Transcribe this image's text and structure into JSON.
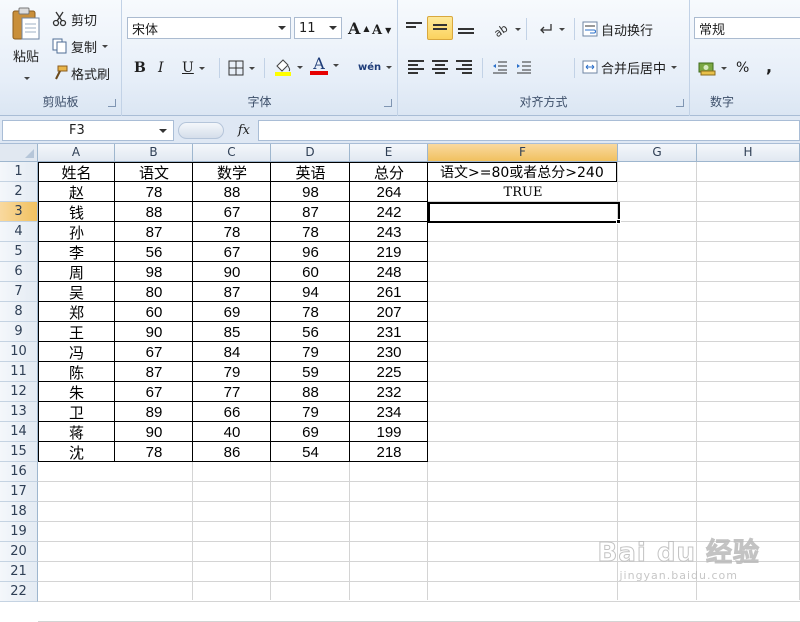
{
  "ribbon": {
    "clipboard": {
      "label": "剪贴板",
      "paste": "粘贴",
      "cut": "剪切",
      "copy": "复制",
      "format_painter": "格式刷"
    },
    "font": {
      "label": "字体",
      "font_name": "宋体",
      "font_size": "11",
      "bold": "B",
      "italic": "I",
      "underline": "U",
      "font_color_letter": "A",
      "phonetic": "wén",
      "grow": "A",
      "shrink": "A"
    },
    "alignment": {
      "label": "对齐方式",
      "wrap_text": "自动换行",
      "merge_center": "合并后居中"
    },
    "number": {
      "label": "数字",
      "format": "常规",
      "percent": "%",
      "comma": ","
    }
  },
  "formula_bar": {
    "name_box": "F3",
    "fx": "fx",
    "formula": ""
  },
  "sheet": {
    "active_cell": "F3",
    "columns": [
      "A",
      "B",
      "C",
      "D",
      "E",
      "F",
      "G",
      "H"
    ],
    "rows": [
      "1",
      "2",
      "3",
      "4",
      "5",
      "6",
      "7",
      "8",
      "9",
      "10",
      "11",
      "12",
      "13",
      "14",
      "15",
      "16",
      "17",
      "18",
      "19",
      "20",
      "21",
      "22"
    ],
    "headers": [
      "姓名",
      "语文",
      "数学",
      "英语",
      "总分"
    ],
    "records": [
      [
        "赵",
        "78",
        "88",
        "98",
        "264"
      ],
      [
        "钱",
        "88",
        "67",
        "87",
        "242"
      ],
      [
        "孙",
        "87",
        "78",
        "78",
        "243"
      ],
      [
        "李",
        "56",
        "67",
        "96",
        "219"
      ],
      [
        "周",
        "98",
        "90",
        "60",
        "248"
      ],
      [
        "吴",
        "80",
        "87",
        "94",
        "261"
      ],
      [
        "郑",
        "60",
        "69",
        "78",
        "207"
      ],
      [
        "王",
        "90",
        "85",
        "56",
        "231"
      ],
      [
        "冯",
        "67",
        "84",
        "79",
        "230"
      ],
      [
        "陈",
        "87",
        "79",
        "59",
        "225"
      ],
      [
        "朱",
        "67",
        "77",
        "88",
        "232"
      ],
      [
        "卫",
        "89",
        "66",
        "79",
        "234"
      ],
      [
        "蒋",
        "90",
        "40",
        "69",
        "199"
      ],
      [
        "沈",
        "78",
        "86",
        "54",
        "218"
      ]
    ],
    "f1": "语文>=80或者总分>240",
    "f2": "TRUE"
  },
  "watermark": {
    "logo": "Bai du 经验",
    "url": "jingyan.baidu.com"
  },
  "colors": {
    "accent": "#f1c15f",
    "ribbon_bg": "#e6eef8",
    "grid_line": "#d4d4d4"
  }
}
